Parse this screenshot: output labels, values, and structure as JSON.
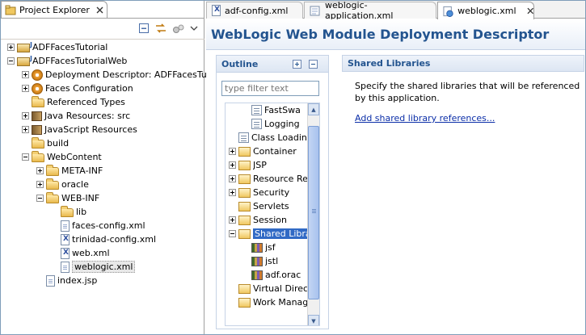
{
  "project_explorer": {
    "tab_label": "Project Explorer",
    "tree": [
      {
        "label": "ADFFacesTutorial",
        "icon": "project-icon",
        "expander": "plus",
        "depth": 0
      },
      {
        "label": "ADFFacesTutorialWeb",
        "icon": "project-icon",
        "expander": "minus",
        "depth": 0
      },
      {
        "label": "Deployment Descriptor: ADFFacesTuto",
        "icon": "deployment-descriptor-icon",
        "expander": "plus",
        "depth": 1
      },
      {
        "label": "Faces Configuration",
        "icon": "faces-config-icon",
        "expander": "plus",
        "depth": 1
      },
      {
        "label": "Referenced Types",
        "icon": "folder-icon",
        "expander": "none",
        "depth": 1
      },
      {
        "label": "Java Resources: src",
        "icon": "java-resources-icon",
        "expander": "plus",
        "depth": 1
      },
      {
        "label": "JavaScript Resources",
        "icon": "library-icon",
        "expander": "plus",
        "depth": 1
      },
      {
        "label": "build",
        "icon": "folder-icon",
        "expander": "none",
        "depth": 1
      },
      {
        "label": "WebContent",
        "icon": "folder-icon",
        "expander": "minus",
        "depth": 1
      },
      {
        "label": "META-INF",
        "icon": "folder-icon",
        "expander": "plus",
        "depth": 2
      },
      {
        "label": "oracle",
        "icon": "folder-icon",
        "expander": "plus",
        "depth": 2
      },
      {
        "label": "WEB-INF",
        "icon": "folder-icon",
        "expander": "minus",
        "depth": 2
      },
      {
        "label": "lib",
        "icon": "folder-icon",
        "expander": "none",
        "depth": 3
      },
      {
        "label": "faces-config.xml",
        "icon": "file-icon",
        "expander": "none",
        "depth": 3
      },
      {
        "label": "trinidad-config.xml",
        "icon": "xml-file-icon",
        "expander": "none",
        "depth": 3
      },
      {
        "label": "web.xml",
        "icon": "xml-file-icon",
        "expander": "none",
        "depth": 3
      },
      {
        "label": "weblogic.xml",
        "icon": "weblogic-file-icon",
        "expander": "none",
        "depth": 3,
        "selected": true
      },
      {
        "label": "index.jsp",
        "icon": "file-icon",
        "expander": "none",
        "depth": 2
      }
    ]
  },
  "editor": {
    "tabs": [
      {
        "label": "adf-config.xml",
        "active": false
      },
      {
        "label": "weblogic-application.xml",
        "active": false
      },
      {
        "label": "weblogic.xml",
        "active": true
      }
    ],
    "title": "WebLogic Web Module Deployment Descriptor",
    "outline": {
      "title": "Outline",
      "filter_placeholder": "type filter text",
      "items": [
        {
          "label": "FastSwa",
          "icon": "file-icon",
          "expander": "none",
          "depth": 1
        },
        {
          "label": "Logging",
          "icon": "file-icon",
          "expander": "none",
          "depth": 1
        },
        {
          "label": "Class Loadin",
          "icon": "file-icon",
          "expander": "none",
          "depth": 0
        },
        {
          "label": "Container",
          "icon": "folder-icon",
          "expander": "plus",
          "depth": 0
        },
        {
          "label": "JSP",
          "icon": "folder-icon",
          "expander": "plus",
          "depth": 0
        },
        {
          "label": "Resource Re",
          "icon": "folder-icon",
          "expander": "plus",
          "depth": 0
        },
        {
          "label": "Security",
          "icon": "folder-icon",
          "expander": "plus",
          "depth": 0
        },
        {
          "label": "Servlets",
          "icon": "folder-icon",
          "expander": "none",
          "depth": 0
        },
        {
          "label": "Session",
          "icon": "folder-icon",
          "expander": "plus",
          "depth": 0
        },
        {
          "label": "Shared Libra",
          "icon": "folder-icon",
          "expander": "minus",
          "depth": 0,
          "selected": true
        },
        {
          "label": "jsf",
          "icon": "library-icon",
          "expander": "none",
          "depth": 1
        },
        {
          "label": "jstl",
          "icon": "library-icon",
          "expander": "none",
          "depth": 1
        },
        {
          "label": "adf.orac",
          "icon": "library-icon",
          "expander": "none",
          "depth": 1
        },
        {
          "label": "Virtual Direct",
          "icon": "folder-icon",
          "expander": "none",
          "depth": 0
        },
        {
          "label": "Work Manag",
          "icon": "folder-icon",
          "expander": "none",
          "depth": 0
        }
      ]
    },
    "detail": {
      "title": "Shared Libraries",
      "description": "Specify the shared libraries that will be referenced by this application.",
      "link": "Add shared library references..."
    }
  }
}
